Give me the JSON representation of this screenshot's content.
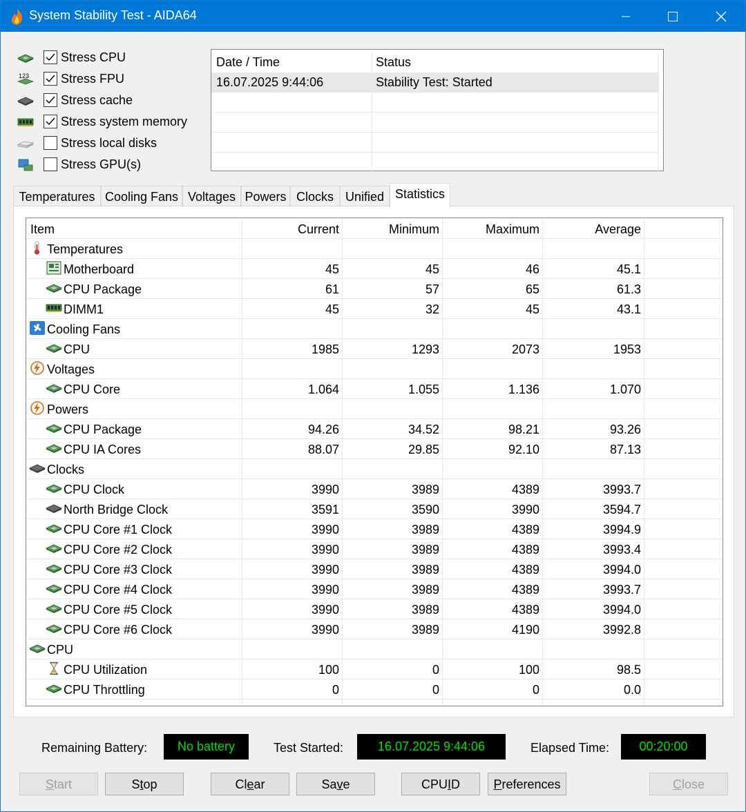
{
  "window": {
    "title": "System Stability Test - AIDA64"
  },
  "stress_options": [
    {
      "label": "Stress CPU",
      "checked": true,
      "icon": "cpu-chip-icon"
    },
    {
      "label": "Stress FPU",
      "checked": true,
      "icon": "fpu-123-icon"
    },
    {
      "label": "Stress cache",
      "checked": true,
      "icon": "cache-chip-icon"
    },
    {
      "label": "Stress system memory",
      "checked": true,
      "icon": "memory-module-icon"
    },
    {
      "label": "Stress local disks",
      "checked": false,
      "icon": "disk-drive-icon"
    },
    {
      "label": "Stress GPU(s)",
      "checked": false,
      "icon": "gpu-display-icon"
    }
  ],
  "status_log": {
    "headers": {
      "datetime": "Date / Time",
      "status": "Status"
    },
    "rows": [
      {
        "datetime": "16.07.2025 9:44:06",
        "status": "Stability Test: Started"
      }
    ]
  },
  "tabs": [
    "Temperatures",
    "Cooling Fans",
    "Voltages",
    "Powers",
    "Clocks",
    "Unified",
    "Statistics"
  ],
  "active_tab": "Statistics",
  "stats": {
    "headers": {
      "item": "Item",
      "current": "Current",
      "minimum": "Minimum",
      "maximum": "Maximum",
      "average": "Average"
    },
    "groups": [
      {
        "name": "Temperatures",
        "icon": "thermometer-icon",
        "rows": [
          {
            "name": "Motherboard",
            "icon": "motherboard-icon",
            "current": "45",
            "minimum": "45",
            "maximum": "46",
            "average": "45.1"
          },
          {
            "name": "CPU Package",
            "icon": "cpu-chip-icon",
            "current": "61",
            "minimum": "57",
            "maximum": "65",
            "average": "61.3"
          },
          {
            "name": "DIMM1",
            "icon": "memory-module-icon",
            "current": "45",
            "minimum": "32",
            "maximum": "45",
            "average": "43.1"
          }
        ]
      },
      {
        "name": "Cooling Fans",
        "icon": "fan-icon",
        "rows": [
          {
            "name": "CPU",
            "icon": "cpu-chip-icon",
            "current": "1985",
            "minimum": "1293",
            "maximum": "2073",
            "average": "1953"
          }
        ]
      },
      {
        "name": "Voltages",
        "icon": "lightning-icon",
        "rows": [
          {
            "name": "CPU Core",
            "icon": "cpu-chip-icon",
            "current": "1.064",
            "minimum": "1.055",
            "maximum": "1.136",
            "average": "1.070"
          }
        ]
      },
      {
        "name": "Powers",
        "icon": "lightning-icon",
        "rows": [
          {
            "name": "CPU Package",
            "icon": "cpu-chip-icon",
            "current": "94.26",
            "minimum": "34.52",
            "maximum": "98.21",
            "average": "93.26"
          },
          {
            "name": "CPU IA Cores",
            "icon": "cpu-chip-icon",
            "current": "88.07",
            "minimum": "29.85",
            "maximum": "92.10",
            "average": "87.13"
          }
        ]
      },
      {
        "name": "Clocks",
        "icon": "chip-dark-icon",
        "rows": [
          {
            "name": "CPU Clock",
            "icon": "cpu-chip-icon",
            "current": "3990",
            "minimum": "3989",
            "maximum": "4389",
            "average": "3993.7"
          },
          {
            "name": "North Bridge Clock",
            "icon": "chip-dark-icon",
            "current": "3591",
            "minimum": "3590",
            "maximum": "3990",
            "average": "3594.7"
          },
          {
            "name": "CPU Core #1 Clock",
            "icon": "cpu-chip-icon",
            "current": "3990",
            "minimum": "3989",
            "maximum": "4389",
            "average": "3994.9"
          },
          {
            "name": "CPU Core #2 Clock",
            "icon": "cpu-chip-icon",
            "current": "3990",
            "minimum": "3989",
            "maximum": "4389",
            "average": "3993.4"
          },
          {
            "name": "CPU Core #3 Clock",
            "icon": "cpu-chip-icon",
            "current": "3990",
            "minimum": "3989",
            "maximum": "4389",
            "average": "3994.0"
          },
          {
            "name": "CPU Core #4 Clock",
            "icon": "cpu-chip-icon",
            "current": "3990",
            "minimum": "3989",
            "maximum": "4389",
            "average": "3993.7"
          },
          {
            "name": "CPU Core #5 Clock",
            "icon": "cpu-chip-icon",
            "current": "3990",
            "minimum": "3989",
            "maximum": "4389",
            "average": "3994.0"
          },
          {
            "name": "CPU Core #6 Clock",
            "icon": "cpu-chip-icon",
            "current": "3990",
            "minimum": "3989",
            "maximum": "4190",
            "average": "3992.8"
          }
        ]
      },
      {
        "name": "CPU",
        "icon": "cpu-chip-icon",
        "rows": [
          {
            "name": "CPU Utilization",
            "icon": "hourglass-icon",
            "current": "100",
            "minimum": "0",
            "maximum": "100",
            "average": "98.5"
          },
          {
            "name": "CPU Throttling",
            "icon": "cpu-chip-icon",
            "current": "0",
            "minimum": "0",
            "maximum": "0",
            "average": "0.0"
          }
        ]
      }
    ]
  },
  "footer": {
    "battery_label": "Remaining Battery:",
    "battery_value": "No battery",
    "started_label": "Test Started:",
    "started_value": "16.07.2025 9:44:06",
    "elapsed_label": "Elapsed Time:",
    "elapsed_value": "00:20:00"
  },
  "buttons": [
    {
      "label": "Start",
      "access_key": "S",
      "enabled": false
    },
    {
      "label": "Stop",
      "access_key": "t",
      "enabled": true
    },
    {
      "label": "Clear",
      "access_key": "e",
      "enabled": true
    },
    {
      "label": "Save",
      "access_key": "v",
      "enabled": true
    },
    {
      "label": "CPUID",
      "access_key": "I",
      "enabled": true
    },
    {
      "label": "Preferences",
      "access_key": "P",
      "enabled": true
    },
    {
      "label": "Close",
      "access_key": "C",
      "enabled": false
    }
  ],
  "colors": {
    "titlebar": "#0078d7",
    "lcd_bg": "#000000",
    "lcd_text": "#00e000",
    "selected_row": "#e8e8e8"
  }
}
